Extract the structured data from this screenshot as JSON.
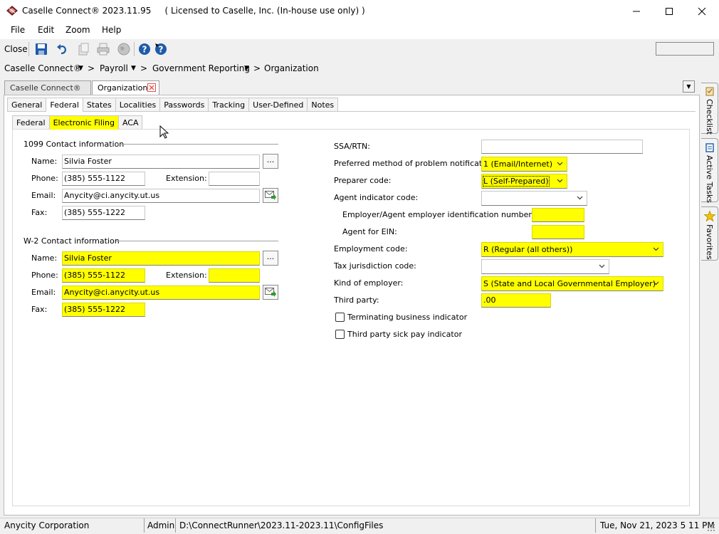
{
  "window": {
    "title": "Caselle Connect® 2023.11.95     ( Licensed to Caselle, Inc. (In-house use only) )"
  },
  "menu": [
    "File",
    "Edit",
    "Zoom",
    "Help"
  ],
  "toolbar": {
    "close_label": "Close",
    "icons": [
      "save-icon",
      "undo-icon",
      "copy-document-icon",
      "print-icon",
      "globe-icon",
      "help-icon",
      "whats-this-help-icon"
    ]
  },
  "breadcrumb": {
    "items": [
      "Caselle Connect®",
      "Payroll",
      "Government Reporting",
      "Organization"
    ],
    "separator": ">"
  },
  "doc_tabs": [
    "Caselle Connect®",
    "Organization"
  ],
  "tabs": [
    "General",
    "Federal",
    "States",
    "Localities",
    "Passwords",
    "Tracking",
    "User-Defined",
    "Notes"
  ],
  "subtabs": [
    "Federal",
    "Electronic Filing",
    "ACA"
  ],
  "contact_1099": {
    "title": "1099 Contact information",
    "name_label": "Name:",
    "name": "Silvia Foster",
    "phone_label": "Phone:",
    "phone": "(385) 555-1122",
    "extension_label": "Extension:",
    "extension": "",
    "email_label": "Email:",
    "email": "Anycity@ci.anycity.ut.us",
    "fax_label": "Fax:",
    "fax": "(385) 555-1222"
  },
  "contact_w2": {
    "title": "W-2 Contact information",
    "name_label": "Name:",
    "name": "Silvia Foster",
    "phone_label": "Phone:",
    "phone": "(385) 555-1122",
    "extension_label": "Extension:",
    "extension": "",
    "email_label": "Email:",
    "email": "Anycity@ci.anycity.ut.us",
    "fax_label": "Fax:",
    "fax": "(385) 555-1222"
  },
  "dots_label": "...",
  "right": {
    "ssa_label": "SSA/RTN:",
    "ssa": "",
    "notify_label": "Preferred method of problem notification:",
    "notify": "1 (Email/Internet)",
    "preparer_label": "Preparer code:",
    "preparer": "L (Self-Prepared)",
    "agent_label": "Agent indicator code:",
    "agent": "",
    "ein_label": "Employer/Agent employer identification number (EIN):",
    "ein": "",
    "agent_ein_label": "Agent for EIN:",
    "agent_ein": "",
    "employment_label": "Employment code:",
    "employment": "R (Regular (all others))",
    "jurisdiction_label": "Tax jurisdiction code:",
    "jurisdiction": "",
    "kind_label": "Kind of employer:",
    "kind": "S (State and Local Governmental Employer)",
    "third_party_label": "Third party:",
    "third_party": ".00",
    "terminating_label": "Terminating business indicator",
    "sick_pay_label": "Third party sick pay indicator"
  },
  "side_tabs": [
    "Checklist",
    "Active Tasks",
    "Favorites"
  ],
  "status": {
    "org": "Anycity Corporation",
    "user": "Admin",
    "path": "D:\\ConnectRunner\\2023.11-2023.11\\ConfigFiles",
    "datetime": "Tue, Nov 21, 2023 5 11 PM"
  },
  "colors": {
    "highlight": "#ffff00",
    "accent_blue": "#1e5ba8"
  }
}
